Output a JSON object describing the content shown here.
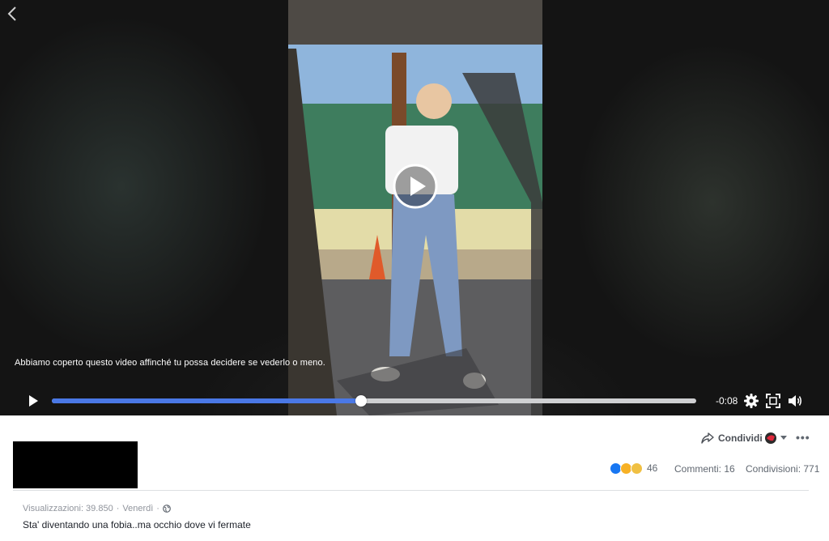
{
  "video": {
    "notice_text": "Abbiamo coperto questo video affinché tu possa decidere se vederlo o meno.",
    "time_remaining": "-0:08",
    "progress_fraction": 0.48,
    "progress_color": "#4a78e6"
  },
  "post": {
    "share_label": "Condividi",
    "reactions_count": "46",
    "comments_label": "Commenti: 16",
    "shares_label": "Condivisioni: 771",
    "views_label": "Visualizzazioni: 39.850",
    "separator": "·",
    "date_label": "Venerdì",
    "caption": "Sta' diventando una fobia..ma occhio dove vi fermate"
  },
  "icons": {
    "back": "chevron-left-icon",
    "play": "play-icon",
    "settings": "gear-icon",
    "fullscreen": "fullscreen-icon",
    "volume": "volume-icon",
    "share": "share-arrow-icon",
    "more": "more-dots-icon",
    "globe": "globe-icon"
  }
}
